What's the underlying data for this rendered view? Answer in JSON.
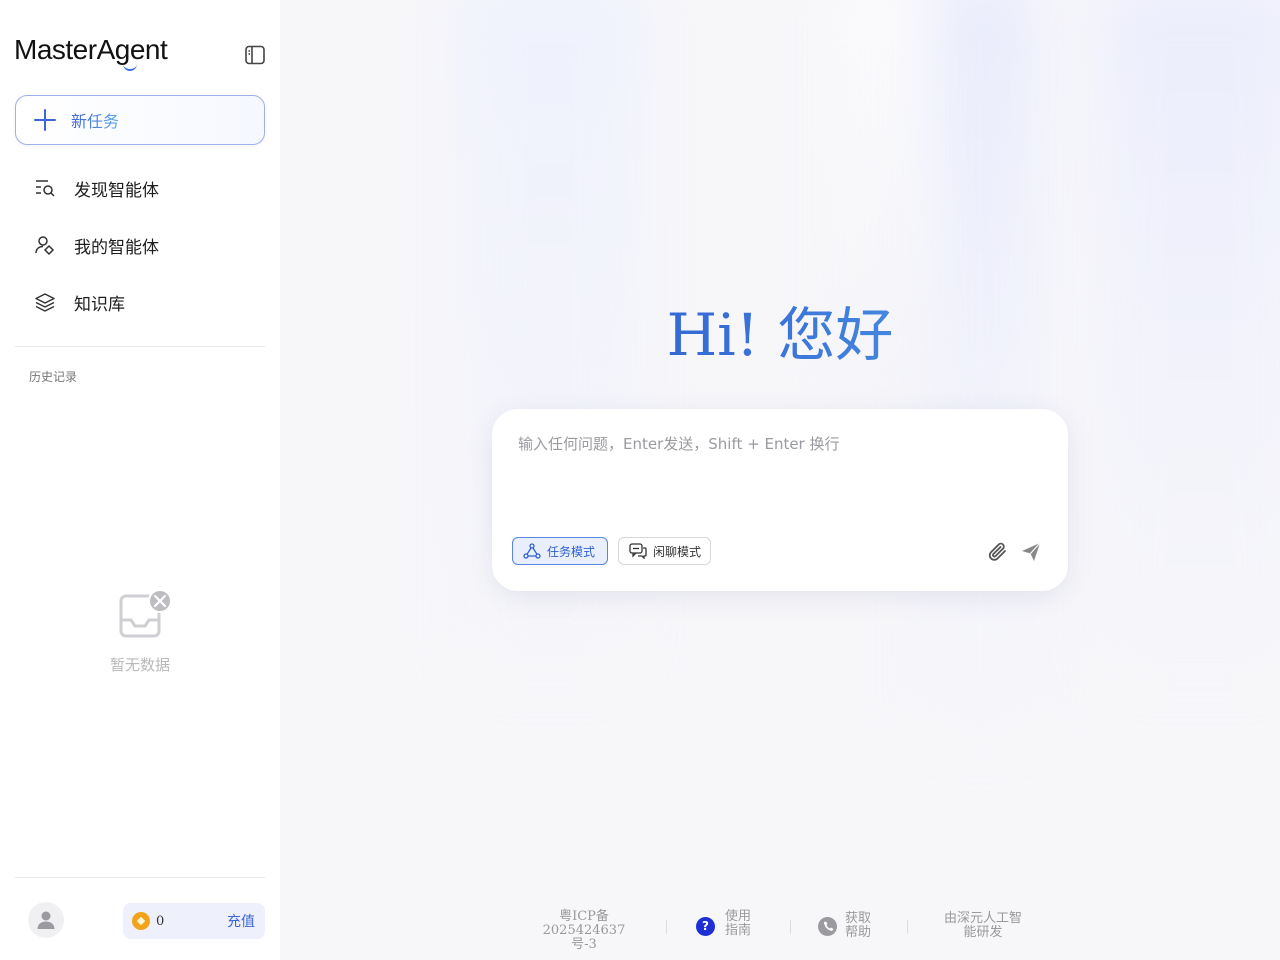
{
  "brand": {
    "name": "MasterAgent"
  },
  "sidebar": {
    "new_task_label": "新任务",
    "items": [
      {
        "label": "发现智能体",
        "icon": "discover-search-icon"
      },
      {
        "label": "我的智能体",
        "icon": "user-agent-icon"
      },
      {
        "label": "知识库",
        "icon": "layers-icon"
      }
    ],
    "history_title": "历史记录",
    "empty_label": "暂无数据",
    "credits": "0",
    "recharge_label": "充值"
  },
  "main": {
    "greeting": "Hi! 您好",
    "input_placeholder": "输入任何问题，Enter发送，Shift + Enter 换行",
    "modes": [
      {
        "label": "任务模式",
        "active": true
      },
      {
        "label": "闲聊模式",
        "active": false
      }
    ]
  },
  "footer": {
    "icp_line1": "粤ICP备",
    "icp_line2": "2025424637号-3",
    "guide_line1": "使用",
    "guide_line2": "指南",
    "help_line1": "获取",
    "help_line2": "帮助",
    "credit_line1": "由深元人工智",
    "credit_line2": "能研发"
  },
  "colors": {
    "accent": "#3b66d4",
    "coin": "#f2a31b",
    "guide_icon": "#1f2fd6"
  }
}
